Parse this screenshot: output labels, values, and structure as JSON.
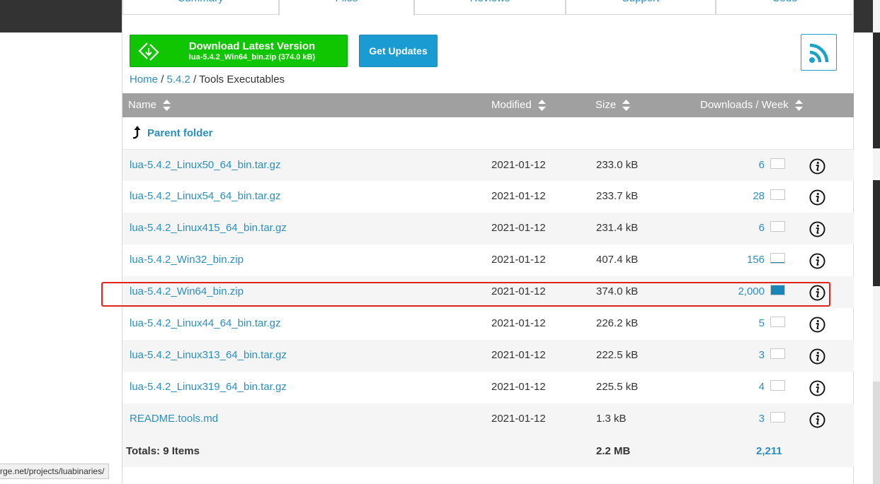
{
  "tabs": [
    "Summary",
    "Files",
    "Reviews",
    "Support",
    "Code"
  ],
  "download": {
    "title": "Download Latest Version",
    "file": "lua-5.4.2_Win64_bin.zip (374.0 kB)"
  },
  "get_updates_label": "Get Updates",
  "rss_icon": "rss-feed-icon",
  "breadcrumb": {
    "home": "Home",
    "sep1": "/",
    "version": "5.4.2",
    "sep2": "/",
    "current": "Tools Executables"
  },
  "columns": {
    "name": "Name",
    "modified": "Modified",
    "size": "Size",
    "downloads": "Downloads / Week"
  },
  "parent_folder_label": "Parent folder",
  "files": [
    {
      "name": "lua-5.4.2_Linux50_64_bin.tar.gz",
      "modified": "2021-01-12",
      "size": "233.0 kB",
      "downloads": "6",
      "level": 0.0
    },
    {
      "name": "lua-5.4.2_Linux54_64_bin.tar.gz",
      "modified": "2021-01-12",
      "size": "233.7 kB",
      "downloads": "28",
      "level": 0.0
    },
    {
      "name": "lua-5.4.2_Linux415_64_bin.tar.gz",
      "modified": "2021-01-12",
      "size": "231.4 kB",
      "downloads": "6",
      "level": 0.0
    },
    {
      "name": "lua-5.4.2_Win32_bin.zip",
      "modified": "2021-01-12",
      "size": "407.4 kB",
      "downloads": "156",
      "level": 0.08
    },
    {
      "name": "lua-5.4.2_Win64_bin.zip",
      "modified": "2021-01-12",
      "size": "374.0 kB",
      "downloads": "2,000",
      "level": 1.0
    },
    {
      "name": "lua-5.4.2_Linux44_64_bin.tar.gz",
      "modified": "2021-01-12",
      "size": "226.2 kB",
      "downloads": "5",
      "level": 0.0
    },
    {
      "name": "lua-5.4.2_Linux313_64_bin.tar.gz",
      "modified": "2021-01-12",
      "size": "222.5 kB",
      "downloads": "3",
      "level": 0.0
    },
    {
      "name": "lua-5.4.2_Linux319_64_bin.tar.gz",
      "modified": "2021-01-12",
      "size": "225.5 kB",
      "downloads": "4",
      "level": 0.0
    },
    {
      "name": "README.tools.md",
      "modified": "2021-01-12",
      "size": "1.3 kB",
      "downloads": "3",
      "level": 0.0
    }
  ],
  "totals": {
    "label": "Totals: 9 Items",
    "size": "2.2 MB",
    "downloads": "2,211"
  },
  "status_url": "rge.net/projects/luabinaries/",
  "colors": {
    "download_green": "#10c600",
    "link_blue": "#2a8fbd",
    "button_blue": "#1a9bd1",
    "header_gray": "#a0a0a0",
    "highlight_red": "#e0251f"
  }
}
